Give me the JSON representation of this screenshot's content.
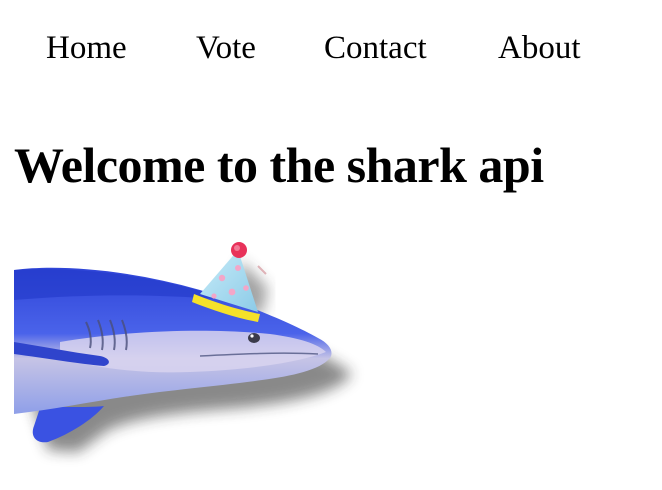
{
  "nav": {
    "items": [
      {
        "label": "Home"
      },
      {
        "label": "Vote"
      },
      {
        "label": "Contact"
      },
      {
        "label": "About"
      }
    ]
  },
  "page": {
    "title": "Welcome to the shark api"
  },
  "image": {
    "icon": "shark-with-party-hat",
    "colors": {
      "shark_blue": "#3d57e6",
      "shark_belly": "#c9c7e8",
      "hat_body": "#a9d8f0",
      "hat_pompom": "#e8325a",
      "hat_trim": "#f5e12a"
    }
  }
}
